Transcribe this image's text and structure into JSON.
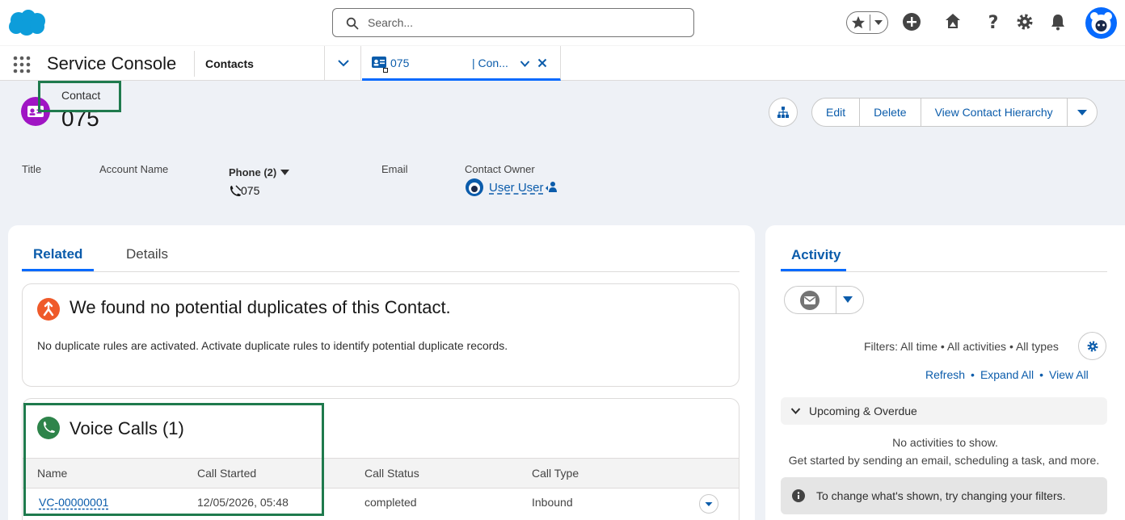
{
  "header": {
    "search_placeholder": "Search..."
  },
  "nav": {
    "app_name": "Service Console",
    "item": "Contacts",
    "tab_label": "075",
    "tab_label_suffix": "| Con..."
  },
  "record": {
    "type": "Contact",
    "name": "075",
    "actions": {
      "edit": "Edit",
      "delete": "Delete",
      "view_hierarchy": "View Contact Hierarchy"
    },
    "fields": {
      "title_label": "Title",
      "account_label": "Account Name",
      "phone_label": "Phone (2)",
      "phone_value": "075",
      "email_label": "Email",
      "owner_label": "Contact Owner",
      "owner_value": "User User"
    }
  },
  "tabs": {
    "related": "Related",
    "details": "Details"
  },
  "duplicates": {
    "title": "We found no potential duplicates of this Contact.",
    "text": "No duplicate rules are activated. Activate duplicate rules to identify potential duplicate records."
  },
  "voice_calls": {
    "title": "Voice Calls (1)",
    "columns": [
      "Name",
      "Call Started",
      "Call Status",
      "Call Type"
    ],
    "rows": [
      {
        "name": "VC-00000001",
        "started": "12/05/2026, 05:48",
        "status": "completed",
        "type": "Inbound"
      }
    ]
  },
  "activity": {
    "tab": "Activity",
    "filters": "Filters: All time • All activities • All types",
    "refresh": "Refresh",
    "expand_all": "Expand All",
    "view_all": "View All",
    "upcoming": "Upcoming & Overdue",
    "no_activities": "No activities to show.",
    "get_started": "Get started by sending an email, scheduling a task, and more.",
    "info": "To change what's shown, try changing your filters."
  },
  "colors": {
    "brand": "#066afe",
    "link": "#0b5cab",
    "contact_icon": "#a015c4",
    "duplicate_icon": "#ef5a2a",
    "voice_icon": "#2e844a",
    "highlight": "#1f7a4d"
  }
}
